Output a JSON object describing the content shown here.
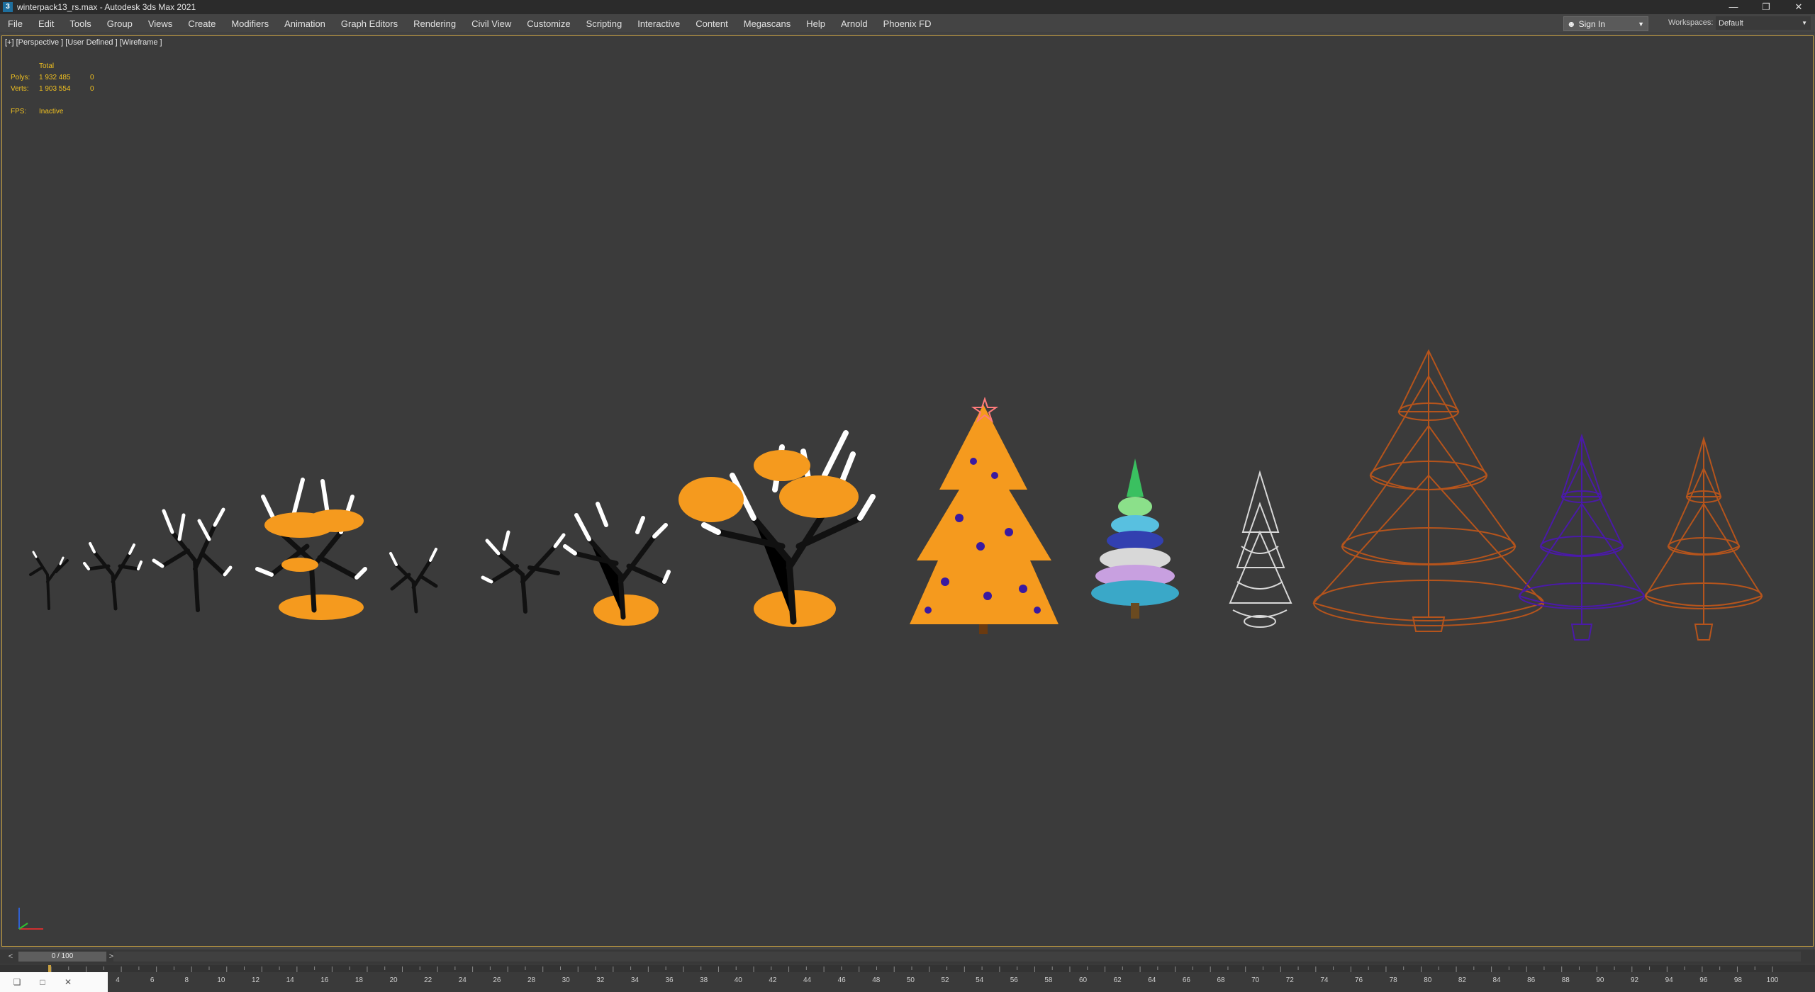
{
  "window": {
    "app_icon": "3",
    "title": "winterpack13_rs.max - Autodesk 3ds Max 2021",
    "minimize": "—",
    "restore": "❐",
    "close": "✕"
  },
  "menu": [
    "File",
    "Edit",
    "Tools",
    "Group",
    "Views",
    "Create",
    "Modifiers",
    "Animation",
    "Graph Editors",
    "Rendering",
    "Civil View",
    "Customize",
    "Scripting",
    "Interactive",
    "Content",
    "Megascans",
    "Help",
    "Arnold",
    "Phoenix FD"
  ],
  "signin": {
    "label": "Sign In",
    "icon": "person-icon"
  },
  "workspaces": {
    "label": "Workspaces:",
    "value": "Default"
  },
  "viewport": {
    "label": "[+] [Perspective ] [User Defined ] [Wireframe ]",
    "stats": {
      "header": "Total",
      "polys_label": "Polys:",
      "polys_total": "1 932 485",
      "polys_sel": "0",
      "verts_label": "Verts:",
      "verts_total": "1 903 554",
      "verts_sel": "0",
      "fps_label": "FPS:",
      "fps_value": "Inactive"
    }
  },
  "colors": {
    "orange": "#f59a1e",
    "white": "#ffffff",
    "black": "#111111",
    "rust": "#b5541c",
    "purple": "#4a1aa8",
    "grey_wire": "#d8d8d8",
    "accent": "#c8a040"
  },
  "timeslider": {
    "value": "0 / 100",
    "prev": "<",
    "next": ">"
  },
  "timeline_ticks": [
    "4",
    "6",
    "8",
    "10",
    "12",
    "14",
    "16",
    "18",
    "20",
    "22",
    "24",
    "26",
    "28",
    "30",
    "32",
    "34",
    "36",
    "38",
    "40",
    "42",
    "44",
    "46",
    "48",
    "50",
    "52",
    "54",
    "56",
    "58",
    "60",
    "62",
    "64",
    "66",
    "68",
    "70",
    "72",
    "74",
    "76",
    "78",
    "80",
    "82",
    "84",
    "86",
    "88",
    "90",
    "92",
    "94",
    "96",
    "98",
    "100"
  ]
}
